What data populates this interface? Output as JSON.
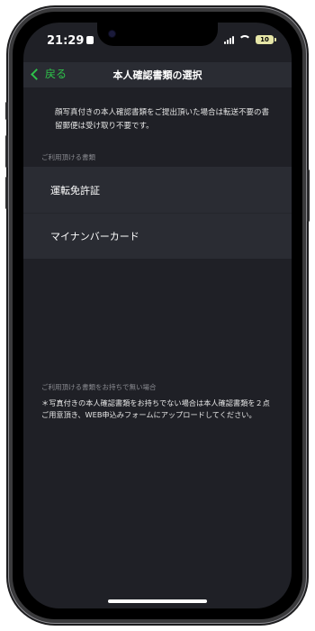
{
  "status_bar": {
    "time": "21:29",
    "battery": "10"
  },
  "navbar": {
    "back_label": "戻る",
    "title": "本人確認書類の選択"
  },
  "notice": {
    "text": "顔写真付きの本人確認書類をご提出頂いた場合は転送不要の書留郵便は受け取り不要です。"
  },
  "available_section": {
    "label": "ご利用頂ける書類",
    "items": [
      {
        "label": "運転免許証"
      },
      {
        "label": "マイナンバーカード"
      }
    ]
  },
  "unavailable_section": {
    "label": "ご利用頂ける書類をお持ちで無い場合",
    "text": "＊写真付きの本人確認書類をお持ちでない場合は本人確認書類を２点ご用意頂き、WEB申込みフォームにアップロードしてください。"
  },
  "colors": {
    "accent": "#2ec24a",
    "background": "#1f2026",
    "cell": "#2a2c33"
  }
}
